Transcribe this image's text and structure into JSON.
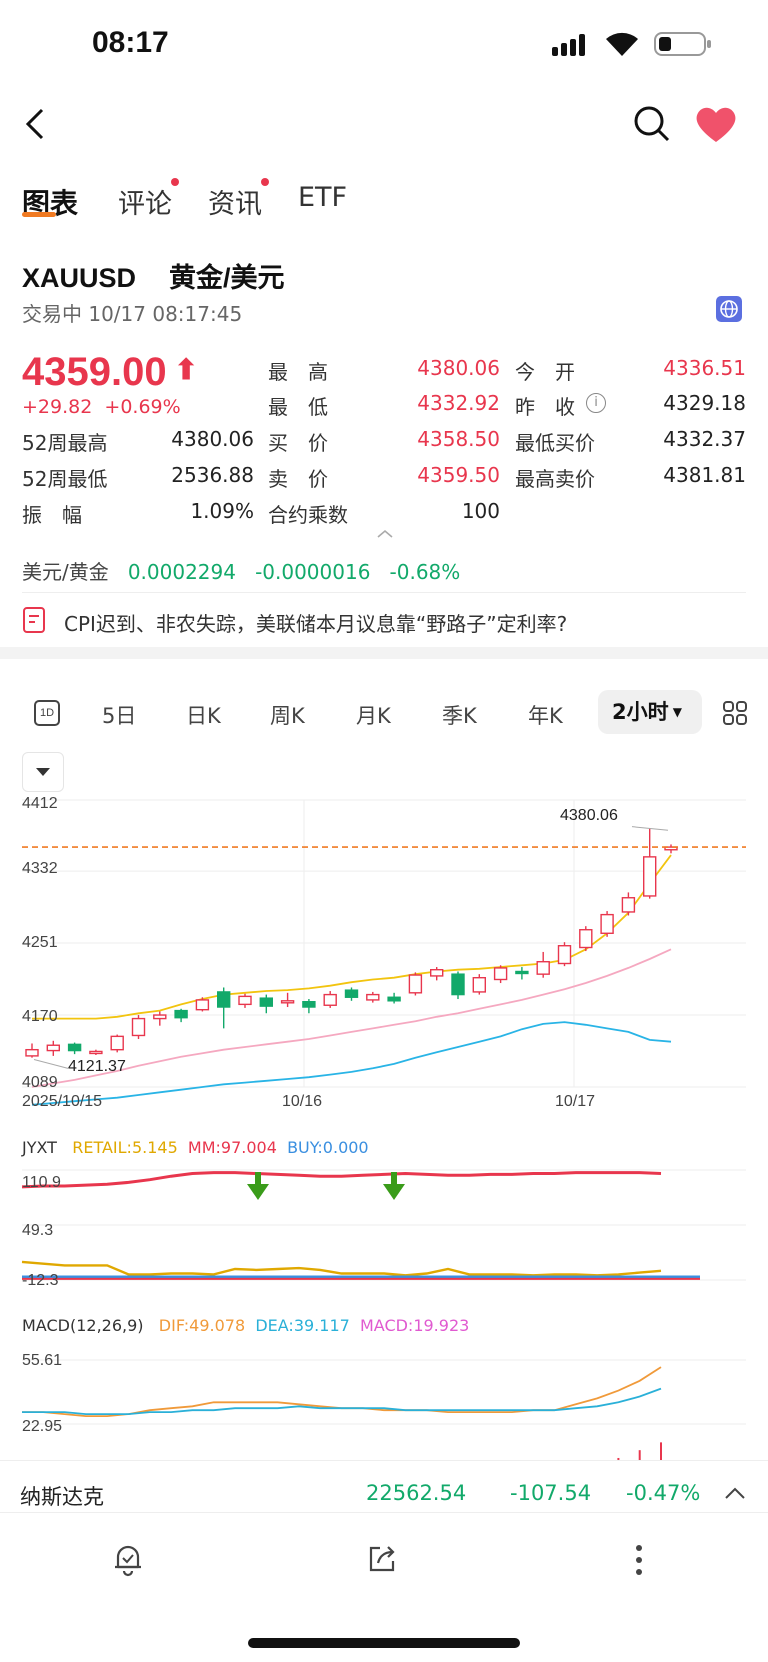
{
  "status": {
    "time": "08:17"
  },
  "tabs": [
    {
      "label": "图表",
      "active": true,
      "dot": false
    },
    {
      "label": "评论",
      "active": false,
      "dot": true
    },
    {
      "label": "资讯",
      "active": false,
      "dot": true
    },
    {
      "label": "ETF",
      "active": false,
      "dot": false
    }
  ],
  "symbol": {
    "code": "XAUUSD",
    "name": "黄金/美元",
    "status": "交易中 10/17 08:17:45"
  },
  "price": {
    "last": "4359.00",
    "change": "+29.82",
    "change_pct": "+0.69%"
  },
  "quote": {
    "high_label": "最　高",
    "high": "4380.06",
    "open_label": "今　开",
    "open": "4336.51",
    "low_label": "最　低",
    "low": "4332.92",
    "prev_label": "昨　收",
    "prev": "4329.18",
    "w52h_label": "52周最高",
    "w52h": "4380.06",
    "bid_label": "买　价",
    "bid": "4358.50",
    "minbid_label": "最低买价",
    "minbid": "4332.37",
    "w52l_label": "52周最低",
    "w52l": "2536.88",
    "ask_label": "卖　价",
    "ask": "4359.50",
    "maxask_label": "最高卖价",
    "maxask": "4381.81",
    "amp_label": "振　幅",
    "amp": "1.09%",
    "mult_label": "合约乘数",
    "mult": "100"
  },
  "cross": {
    "label": "美元/黄金",
    "value": "0.0002294",
    "change": "-0.0000016",
    "pct": "-0.68%"
  },
  "news": {
    "text": "CPI迟到、非农失踪，美联储本月议息靠“野路子”定利率?"
  },
  "periods": [
    "5日",
    "日K",
    "周K",
    "月K",
    "季K",
    "年K"
  ],
  "period_selected": "2小时",
  "period_icon": "1D",
  "chart_data": {
    "type": "candlestick",
    "y_ticks": [
      "4412",
      "4332",
      "4251",
      "4170",
      "4089"
    ],
    "x_ticks": [
      "2025/10/15",
      "10/16",
      "10/17"
    ],
    "high_annot": "4380.06",
    "low_annot": "4121.37",
    "current_price_line": 4359.0,
    "candles": [
      [
        4124,
        4131,
        4122,
        4138
      ],
      [
        4130,
        4136,
        4124,
        4141
      ],
      [
        4137,
        4130,
        4126,
        4139
      ],
      [
        4128,
        4129,
        4125,
        4131
      ],
      [
        4131,
        4146,
        4128,
        4148
      ],
      [
        4147,
        4166,
        4143,
        4170
      ],
      [
        4166,
        4170,
        4158,
        4174
      ],
      [
        4175,
        4167,
        4162,
        4177
      ],
      [
        4176,
        4187,
        4174,
        4190
      ],
      [
        4196,
        4179,
        4155,
        4201
      ],
      [
        4182,
        4191,
        4178,
        4194
      ],
      [
        4189,
        4180,
        4172,
        4193
      ],
      [
        4184,
        4186,
        4179,
        4195
      ],
      [
        4185,
        4179,
        4172,
        4188
      ],
      [
        4181,
        4193,
        4178,
        4197
      ],
      [
        4198,
        4190,
        4186,
        4201
      ],
      [
        4187,
        4193,
        4184,
        4196
      ],
      [
        4190,
        4186,
        4183,
        4195
      ],
      [
        4195,
        4215,
        4192,
        4218
      ],
      [
        4214,
        4221,
        4209,
        4224
      ],
      [
        4216,
        4193,
        4188,
        4219
      ],
      [
        4196,
        4212,
        4193,
        4216
      ],
      [
        4210,
        4223,
        4206,
        4226
      ],
      [
        4219,
        4218,
        4210,
        4224
      ],
      [
        4216,
        4230,
        4212,
        4241
      ],
      [
        4228,
        4248,
        4225,
        4252
      ],
      [
        4246,
        4266,
        4242,
        4270
      ],
      [
        4262,
        4283,
        4258,
        4287
      ],
      [
        4286,
        4302,
        4282,
        4308
      ],
      [
        4304,
        4348,
        4301,
        4380
      ],
      [
        4356,
        4359,
        4352,
        4362
      ]
    ],
    "ma_yellow": [
      4166,
      4166,
      4166,
      4166,
      4168,
      4172,
      4175,
      4182,
      4188,
      4193,
      4195,
      4197,
      4198,
      4200,
      4203,
      4207,
      4210,
      4212,
      4216,
      4219,
      4221,
      4222,
      4224,
      4226,
      4228,
      4232,
      4244,
      4262,
      4285,
      4318,
      4350
    ],
    "ma_pink": [
      4089,
      4093,
      4097,
      4102,
      4107,
      4113,
      4118,
      4123,
      4127,
      4131,
      4134,
      4137,
      4140,
      4143,
      4147,
      4151,
      4155,
      4159,
      4163,
      4168,
      4172,
      4177,
      4182,
      4187,
      4193,
      4199,
      4206,
      4214,
      4223,
      4233,
      4244
    ],
    "ma_blue": [
      4069,
      4071,
      4073,
      4075,
      4077,
      4080,
      4083,
      4086,
      4089,
      4092,
      4094,
      4096,
      4098,
      4100,
      4103,
      4106,
      4110,
      4115,
      4122,
      4128,
      4134,
      4140,
      4146,
      4154,
      4160,
      4162,
      4159,
      4155,
      4151,
      4142,
      4140
    ],
    "jyxt": {
      "label": "JYXT",
      "retail": "RETAIL:5.145",
      "mm": "MM:97.004",
      "buy": "BUY:0.000",
      "ticks": [
        "110.9",
        "49.3",
        "-12.3"
      ]
    },
    "macd": {
      "label": "MACD(12,26,9)",
      "dif": "DIF:49.078",
      "dea": "DEA:39.117",
      "macd": "MACD:19.923",
      "ticks": [
        "55.61",
        "22.95"
      ]
    }
  },
  "ticker": {
    "name": "纳斯达克",
    "value": "22562.54",
    "change": "-107.54",
    "pct": "-0.47%"
  },
  "colors": {
    "up": "#e8364d",
    "down": "#12a96a",
    "accent_orange": "#f07a22"
  }
}
